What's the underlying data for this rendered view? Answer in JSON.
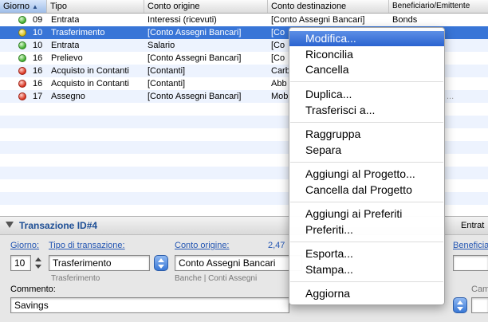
{
  "table": {
    "headers": {
      "day": "Giorno",
      "type": "Tipo",
      "origin": "Conto origine",
      "destination": "Conto destinazione",
      "payee": "Beneficiario/Emittente"
    },
    "rows": [
      {
        "status": "green",
        "day": "09",
        "type": "Entrata",
        "origin": "Interessi (ricevuti)",
        "destination": "[Conto Assegni Bancari]",
        "payee": "Bonds"
      },
      {
        "status": "yellow",
        "day": "10",
        "type": "Trasferimento",
        "origin": "[Conto Assegni Bancari]",
        "destination": "[Co",
        "payee": ""
      },
      {
        "status": "green",
        "day": "10",
        "type": "Entrata",
        "origin": "Salario",
        "destination": "[Co",
        "payee": ""
      },
      {
        "status": "green",
        "day": "16",
        "type": "Prelievo",
        "origin": "[Conto Assegni Bancari]",
        "destination": "[Co",
        "payee": ""
      },
      {
        "status": "red",
        "day": "16",
        "type": "Acquisto in Contanti",
        "origin": "[Contanti]",
        "destination": "Carb",
        "payee": ""
      },
      {
        "status": "red",
        "day": "16",
        "type": "Acquisto in Contanti",
        "origin": "[Contanti]",
        "destination": "Abb",
        "payee": ""
      },
      {
        "status": "red",
        "day": "17",
        "type": "Assegno",
        "origin": "[Conto Assegni Bancari]",
        "destination": "Mob",
        "payee": "..."
      }
    ]
  },
  "detail": {
    "title": "Transazione ID#4",
    "right_label": "Entrat",
    "day_label": "Giorno:",
    "day_value": "10",
    "type_label": "Tipo di transazione:",
    "type_value": "Trasferimento",
    "type_sub": "Trasferimento",
    "origin_label": "Conto origine:",
    "origin_value": "Conto Assegni Bancari",
    "origin_sub": "Banche | Conti Assegni",
    "amount_fragment": "2,47",
    "payee_label": "Beneficia",
    "comment_label": "Commento:",
    "comment_value": "Savings",
    "right_small": "Cam"
  },
  "menu": {
    "items": [
      {
        "label": "Modifica...",
        "highlighted": true
      },
      {
        "label": "Riconcilia"
      },
      {
        "label": "Cancella"
      },
      {
        "label": "Duplica..."
      },
      {
        "label": "Trasferisci a..."
      },
      {
        "label": "Raggruppa"
      },
      {
        "label": "Separa"
      },
      {
        "label": "Aggiungi al Progetto..."
      },
      {
        "label": "Cancella dal Progetto"
      },
      {
        "label": "Aggiungi ai Preferiti"
      },
      {
        "label": "Preferiti..."
      },
      {
        "label": "Esporta..."
      },
      {
        "label": "Stampa..."
      },
      {
        "label": "Aggiorna"
      }
    ]
  },
  "colors": {
    "selection": "#3875d7",
    "alt_row": "#edf3fe",
    "menu_highlight": "#2a63d0",
    "link_label": "#2456b3"
  }
}
